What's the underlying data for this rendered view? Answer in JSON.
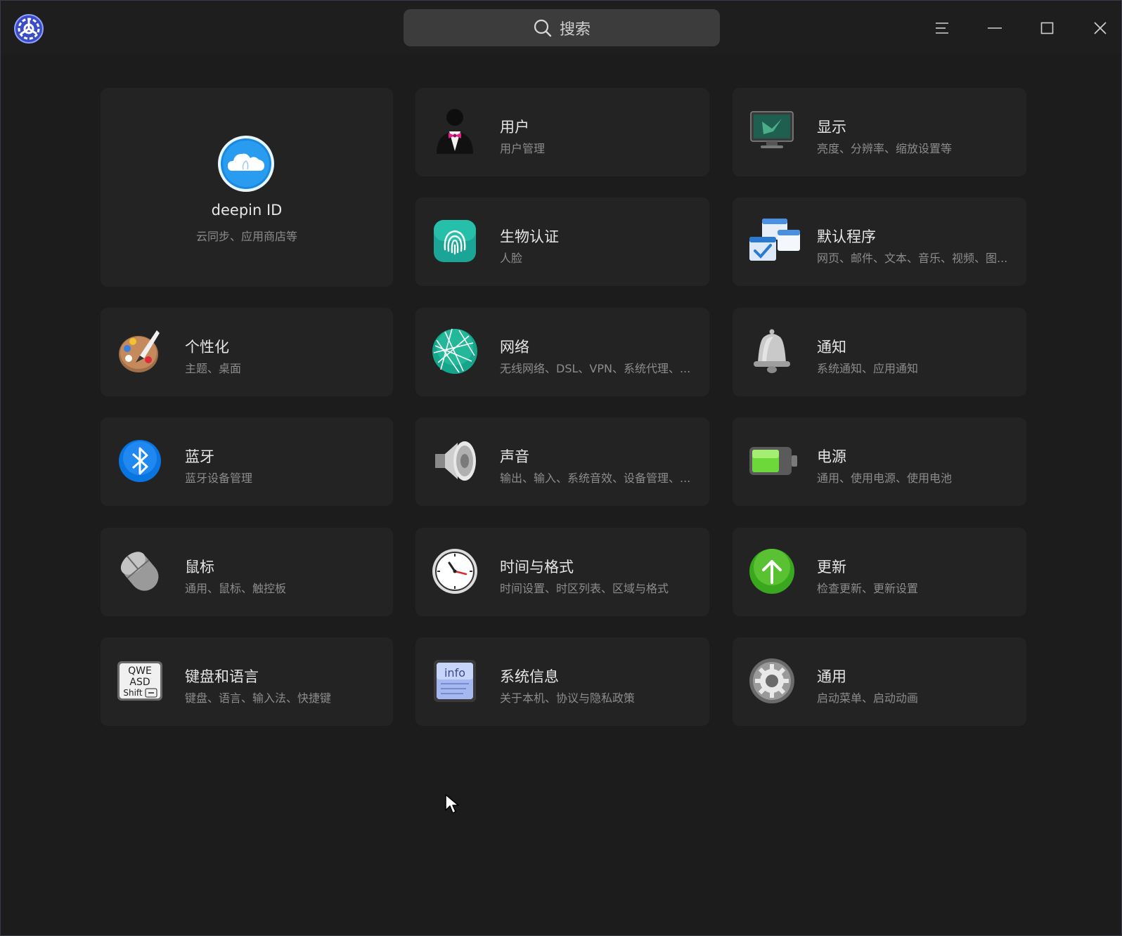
{
  "search": {
    "placeholder": "搜索"
  },
  "deepin_id": {
    "title": "deepin ID",
    "subtitle": "云同步、应用商店等"
  },
  "modules": [
    {
      "title": "用户",
      "subtitle": "用户管理"
    },
    {
      "title": "显示",
      "subtitle": "亮度、分辨率、缩放设置等"
    },
    {
      "title": "生物认证",
      "subtitle": "人脸"
    },
    {
      "title": "默认程序",
      "subtitle": "网页、邮件、文本、音乐、视频、图..."
    },
    {
      "title": "个性化",
      "subtitle": "主题、桌面"
    },
    {
      "title": "网络",
      "subtitle": "无线网络、DSL、VPN、系统代理、..."
    },
    {
      "title": "通知",
      "subtitle": "系统通知、应用通知"
    },
    {
      "title": "蓝牙",
      "subtitle": "蓝牙设备管理"
    },
    {
      "title": "声音",
      "subtitle": "输出、输入、系统音效、设备管理、..."
    },
    {
      "title": "电源",
      "subtitle": "通用、使用电源、使用电池"
    },
    {
      "title": "鼠标",
      "subtitle": "通用、鼠标、触控板"
    },
    {
      "title": "时间与格式",
      "subtitle": "时间设置、时区列表、区域与格式"
    },
    {
      "title": "更新",
      "subtitle": "检查更新、更新设置"
    },
    {
      "title": "键盘和语言",
      "subtitle": "键盘、语言、输入法、快捷键"
    },
    {
      "title": "系统信息",
      "subtitle": "关于本机、协议与隐私政策"
    },
    {
      "title": "通用",
      "subtitle": "启动菜单、启动动画"
    }
  ],
  "icon_text": {
    "keyboard_row1": "QWE",
    "keyboard_row2": "ASD",
    "keyboard_shift": "Shift",
    "info": "info"
  },
  "colors": {
    "background": "#1c1c1c",
    "card": "#232323",
    "search": "#3c3c3c",
    "text": "#e6e6e6",
    "subtext": "#8c8c8c"
  }
}
